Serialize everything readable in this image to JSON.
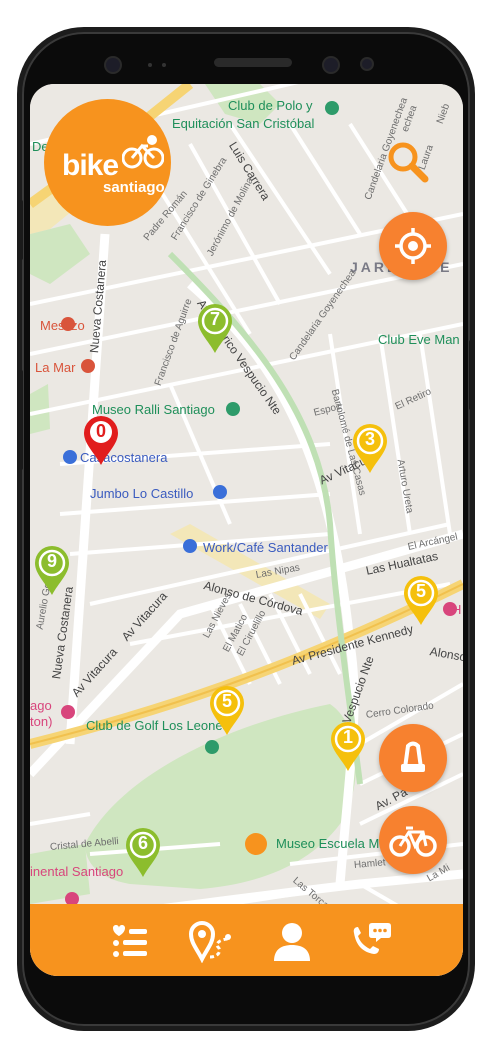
{
  "app": {
    "name": "bike",
    "city": "santiago"
  },
  "map": {
    "places": [
      {
        "id": "club-polo-1",
        "text": "Club de Polo y",
        "style": "green"
      },
      {
        "id": "club-polo-2",
        "text": "Equitación San Cristóbal",
        "style": "green"
      },
      {
        "id": "de-left",
        "text": "De",
        "style": "green"
      },
      {
        "id": "jardin",
        "text": "JARDÍN DE",
        "style": "big"
      },
      {
        "id": "club-eve",
        "text": "Club Eve Man",
        "style": "green"
      },
      {
        "id": "mestizo",
        "text": "Mestizo",
        "style": "orange"
      },
      {
        "id": "la-mar",
        "text": "La Mar",
        "style": "orange"
      },
      {
        "id": "museo-ralli",
        "text": "Museo Ralli Santiago",
        "style": "green"
      },
      {
        "id": "casacostanera",
        "text": "Casacostanera",
        "style": "blue"
      },
      {
        "id": "jumbo",
        "text": "Jumbo Lo Castillo",
        "style": "blue"
      },
      {
        "id": "work-cafe",
        "text": "Work/Café Santander",
        "style": "blue"
      },
      {
        "id": "club-golf",
        "text": "Club de Golf Los Leones",
        "style": "green"
      },
      {
        "id": "museo-escuela",
        "text": "Museo Escuela M",
        "style": "green"
      },
      {
        "id": "ago-left",
        "text": "ago",
        "style": "pink"
      },
      {
        "id": "ton-left",
        "text": "ton)",
        "style": "pink"
      },
      {
        "id": "h-right",
        "text": "H",
        "style": "pink"
      },
      {
        "id": "continental",
        "text": "inental Santiago",
        "style": "pink"
      }
    ],
    "streets": [
      {
        "id": "luis-carrera",
        "text": "Luis Carrera",
        "cls": "main"
      },
      {
        "id": "candelaria",
        "text": "Candelaria Goyenechea",
        "cls": ""
      },
      {
        "id": "padre-roman",
        "text": "Padre Román",
        "cls": ""
      },
      {
        "id": "fco-ginebra",
        "text": "Francisco de Ginebra",
        "cls": ""
      },
      {
        "id": "jeronimo",
        "text": "Jerónimo de Molina",
        "cls": ""
      },
      {
        "id": "nueva-costanera",
        "text": "Nueva Costanera",
        "cls": "main"
      },
      {
        "id": "fco-aguirre",
        "text": "Francisco de Aguirre",
        "cls": ""
      },
      {
        "id": "av-vespucio",
        "text": "Av. Américo Vespucio Nte",
        "cls": "main"
      },
      {
        "id": "candelaria-2",
        "text": "Candelaria Goyenechea",
        "cls": ""
      },
      {
        "id": "bartolome",
        "text": "Bartolomé de Las Casas",
        "cls": ""
      },
      {
        "id": "espoz",
        "text": "Espoz",
        "cls": ""
      },
      {
        "id": "el-retiro",
        "text": "El Retiro",
        "cls": ""
      },
      {
        "id": "av-vitacura-right",
        "text": "Av Vitacura",
        "cls": "main"
      },
      {
        "id": "arturo-urena",
        "text": "Arturo Ureta",
        "cls": ""
      },
      {
        "id": "las-hualtatas",
        "text": "Las Hualtatas",
        "cls": "main"
      },
      {
        "id": "el-arcangel",
        "text": "El Arcángel",
        "cls": ""
      },
      {
        "id": "alonso-cordova",
        "text": "Alonso de Córdova",
        "cls": "main"
      },
      {
        "id": "las-nipas",
        "text": "Las Nipas",
        "cls": ""
      },
      {
        "id": "av-vitacura-left",
        "text": "Av Vitacura",
        "cls": "main"
      },
      {
        "id": "los-nieves",
        "text": "Las Nieves",
        "cls": ""
      },
      {
        "id": "el-matico",
        "text": "El Matico",
        "cls": ""
      },
      {
        "id": "el-ciruelillo",
        "text": "El Ciruelillo",
        "cls": ""
      },
      {
        "id": "av-pdte-kennedy",
        "text": "Av Presidente Kennedy",
        "cls": "main"
      },
      {
        "id": "alonso-right",
        "text": "Alonso",
        "cls": "main"
      },
      {
        "id": "aurelio",
        "text": "Aurelio Go",
        "cls": ""
      },
      {
        "id": "nueva-costanera-2",
        "text": "Nueva Costanera",
        "cls": "main"
      },
      {
        "id": "av-vitacura-2",
        "text": "Av Vitacura",
        "cls": "main"
      },
      {
        "id": "vespucio-nte",
        "text": "Vespucio Nte",
        "cls": "main"
      },
      {
        "id": "cerro-colorado",
        "text": "Cerro Colorado",
        "cls": ""
      },
      {
        "id": "av-pa",
        "text": "Av. Pa",
        "cls": "main"
      },
      {
        "id": "cristal-abelli",
        "text": "Cristal de Abelli",
        "cls": ""
      },
      {
        "id": "hamlet",
        "text": "Hamlet",
        "cls": ""
      },
      {
        "id": "las-torcazas",
        "text": "Las Torcazas",
        "cls": ""
      },
      {
        "id": "la-mi",
        "text": "La Mi",
        "cls": ""
      },
      {
        "id": "laura-noble",
        "text": "Laura",
        "cls": ""
      },
      {
        "id": "nieb",
        "text": "Nieb",
        "cls": ""
      },
      {
        "id": "echea",
        "text": "echea",
        "cls": ""
      }
    ]
  },
  "stations": [
    {
      "id": "station-7",
      "count": "7",
      "color": "#8cbd2d"
    },
    {
      "id": "station-0",
      "count": "0",
      "color": "#e11d1d"
    },
    {
      "id": "station-3",
      "count": "3",
      "color": "#f5c00c"
    },
    {
      "id": "station-9",
      "count": "9",
      "color": "#8cbd2d"
    },
    {
      "id": "station-5a",
      "count": "5",
      "color": "#f5c00c"
    },
    {
      "id": "station-5b",
      "count": "5",
      "color": "#f5c00c"
    },
    {
      "id": "station-1",
      "count": "1",
      "color": "#f5c00c"
    },
    {
      "id": "station-6",
      "count": "6",
      "color": "#8cbd2d"
    }
  ],
  "colors": {
    "brand": "#f7931e",
    "fab": "#f7812f",
    "green_pin": "#8cbd2d",
    "yellow_pin": "#f5c00c",
    "red_pin": "#e11d1d"
  },
  "controls": {
    "search": "search-icon",
    "locate": "crosshair-icon",
    "lock": "bike-lock-icon",
    "bike": "bicycle-icon"
  },
  "bottom_nav": [
    {
      "id": "list",
      "icon": "list-heart-icon"
    },
    {
      "id": "route",
      "icon": "route-pin-icon"
    },
    {
      "id": "profile",
      "icon": "user-icon"
    },
    {
      "id": "support",
      "icon": "phone-chat-icon"
    }
  ]
}
